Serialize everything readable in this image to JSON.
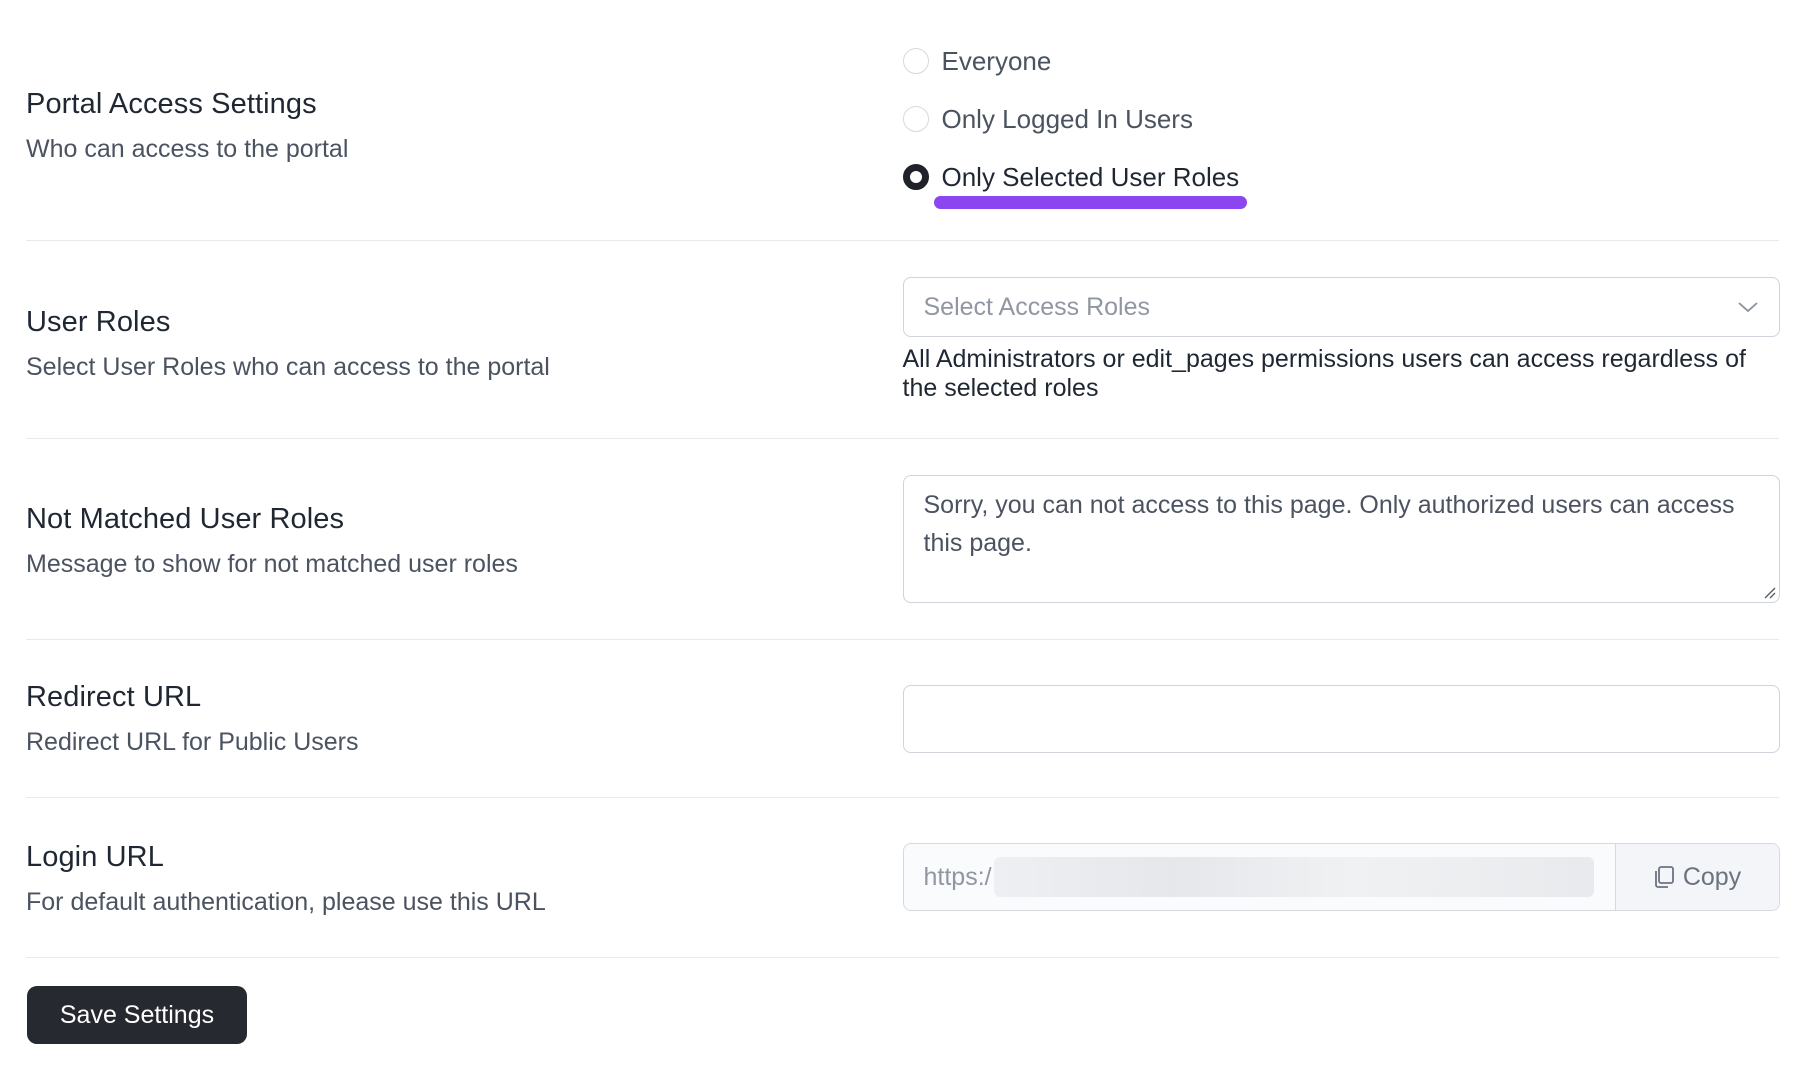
{
  "portal_access": {
    "title": "Portal Access Settings",
    "description": "Who can access to the portal",
    "options": [
      {
        "label": "Everyone",
        "checked": false
      },
      {
        "label": "Only Logged In Users",
        "checked": false
      },
      {
        "label": "Only Selected User Roles",
        "checked": true
      }
    ],
    "highlight_color": "#8b46f0"
  },
  "user_roles": {
    "title": "User Roles",
    "description": "Select User Roles who can access to the portal",
    "select_placeholder": "Select Access Roles",
    "help_text": "All Administrators or edit_pages permissions users can access regardless of the selected roles"
  },
  "not_matched": {
    "title": "Not Matched User Roles",
    "description": "Message to show for not matched user roles",
    "message": "Sorry, you can not access to this page. Only authorized users can access this page."
  },
  "redirect": {
    "title": "Redirect URL",
    "description": "Redirect URL for Public Users",
    "value": ""
  },
  "login": {
    "title": "Login URL",
    "description": "For default authentication, please use this URL",
    "url_prefix": "https:/",
    "copy_label": "Copy"
  },
  "save_label": "Save Settings",
  "icons": {
    "chevron": "chevron-down-icon",
    "copy": "copy-icon",
    "resize": "resize-handle-icon"
  }
}
